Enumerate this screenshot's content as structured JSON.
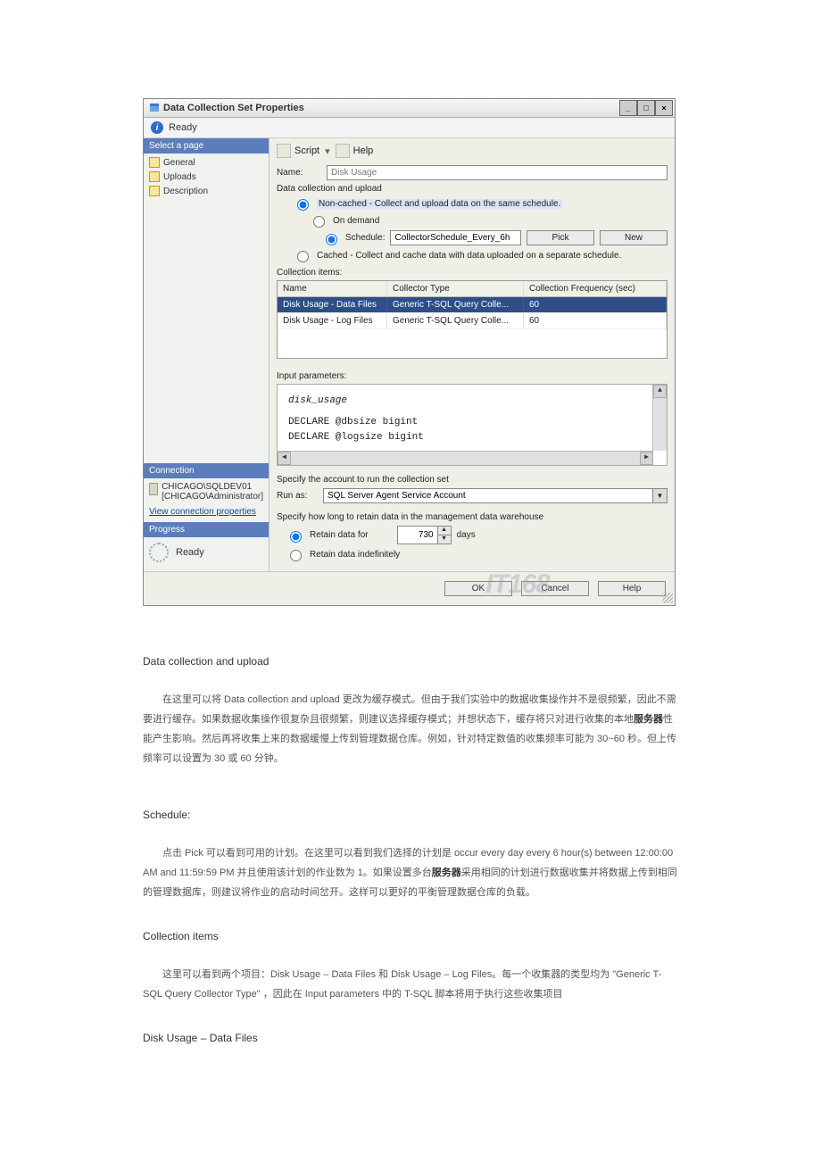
{
  "dialog": {
    "title": "Data Collection Set Properties",
    "ready": "Ready",
    "toolbar": {
      "script": "Script",
      "help": "Help",
      "sep": "▾"
    },
    "left": {
      "selectPage": "Select a page",
      "nav": [
        "General",
        "Uploads",
        "Description"
      ],
      "connectionHead": "Connection",
      "server": "CHICAGO\\SQLDEV01",
      "user": "[CHICAGO\\Administrator]",
      "viewConn": "View connection properties",
      "progressHead": "Progress",
      "progress": "Ready"
    },
    "form": {
      "nameLabel": "Name:",
      "nameValue": "Disk Usage",
      "dcuLabel": "Data collection and upload",
      "radioNonCached": "Non-cached - Collect and upload data on the same schedule.",
      "radioOnDemand": "On demand",
      "radioSchedule": "Schedule:",
      "scheduleValue": "CollectorSchedule_Every_6h",
      "btnPick": "Pick",
      "btnNew": "New",
      "radioCached": "Cached - Collect and cache data with data uploaded on a separate schedule.",
      "itemsLabel": "Collection items:",
      "grid": {
        "headers": [
          "Name",
          "Collector Type",
          "Collection Frequency (sec)"
        ],
        "rows": [
          {
            "name": "Disk Usage - Data Files",
            "type": "Generic T-SQL Query Colle...",
            "freq": "60"
          },
          {
            "name": "Disk Usage - Log Files",
            "type": "Generic T-SQL Query Colle...",
            "freq": "60"
          }
        ]
      },
      "paramsLabel": "Input parameters:",
      "paramsLine1": "disk_usage",
      "paramsLine2": "DECLARE @dbsize bigint",
      "paramsLine3": "DECLARE @logsize bigint",
      "acctLabel": "Specify the account to run the collection set",
      "runAsLabel": "Run as:",
      "runAsValue": "SQL Server Agent Service Account",
      "retainLabel": "Specify how long to retain data in the management data warehouse",
      "retainFor": "Retain data for",
      "retainDays": "730",
      "daysUnit": "days",
      "retainIndef": "Retain data indefinitely"
    },
    "footer": {
      "ok": "OK",
      "cancel": "Cancel",
      "help": "Help",
      "watermark": "IT168"
    }
  },
  "article": {
    "h1": "Data collection and upload",
    "p1a": "在这里可以将 Data collection and upload 更改为缓存模式。但由于我们实验中的数据收集操作并不是很频繁，因此不需要进行缓存。如果数据收集操作很复杂且很频繁，则建议选择缓存模式；并想状态下，缓存将只对进行收集的本地",
    "p1b": "服务器",
    "p1c": "性能产生影响。然后再将收集上来的数据缓慢上传到管理数据仓库。例如，针对特定数值的收集频率可能为 30~60 秒。但上传频率可以设置为 30 或 60 分钟。",
    "h2": "Schedule:",
    "p2a": "点击 Pick 可以看到可用的计划。在这里可以看到我们选择的计划是 occur every day every 6 hour(s) between 12:00:00 AM and 11:59:59 PM 并且使用该计划的作业数为 1。如果设置多台",
    "p2b": "服务器",
    "p2c": "采用相同的计划进行数据收集并将数据上传到相同的管理数据库，则建议将作业的启动时间岔开。这样可以更好的平衡管理数据仓库的负载。",
    "h3": "Collection items",
    "p3": "这里可以看到两个项目：Disk Usage – Data Files 和 Disk Usage – Log Files。每一个收集器的类型均为 \"Generic T-SQL Query Collector Type\" ，因此在 Input parameters 中的 T-SQL 脚本将用于执行这些收集项目",
    "h4": "Disk Usage – Data Files"
  }
}
